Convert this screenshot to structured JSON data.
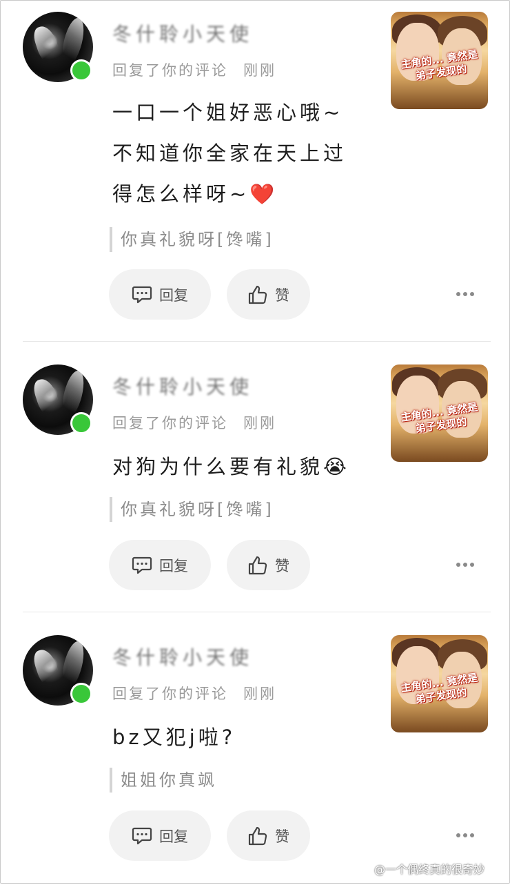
{
  "comments": [
    {
      "username": "冬什聆小天使",
      "subtitle": "回复了你的评论",
      "time": "刚刚",
      "body": [
        "一口一个姐好恶心哦~",
        "不知道你全家在天上过",
        "得怎么样呀~❤️"
      ],
      "quote": "你真礼貌呀[馋嘴]",
      "reply_label": "回复",
      "like_label": "赞",
      "thumb_text": "主角的... 竟然是弟子发现的"
    },
    {
      "username": "冬什聆小天使",
      "subtitle": "回复了你的评论",
      "time": "刚刚",
      "body": [
        "对狗为什么要有礼貌😭"
      ],
      "quote": "你真礼貌呀[馋嘴]",
      "reply_label": "回复",
      "like_label": "赞",
      "thumb_text": "主角的... 竟然是弟子发现的"
    },
    {
      "username": "冬什聆小天使",
      "subtitle": "回复了你的评论",
      "time": "刚刚",
      "body": [
        "bz又犯j啦?"
      ],
      "quote": "姐姐你真飒",
      "reply_label": "回复",
      "like_label": "赞",
      "thumb_text": "主角的... 竟然是弟子发现的"
    }
  ],
  "watermark": "@一个偶终真的很奇妙",
  "colors": {
    "online": "#39c739",
    "muted_text": "#9a9a9a",
    "button_bg": "#f2f2f2"
  },
  "icons": [
    "comment-bubble-icon",
    "thumbs-up-icon",
    "more-dots-icon",
    "weibo-icon"
  ]
}
